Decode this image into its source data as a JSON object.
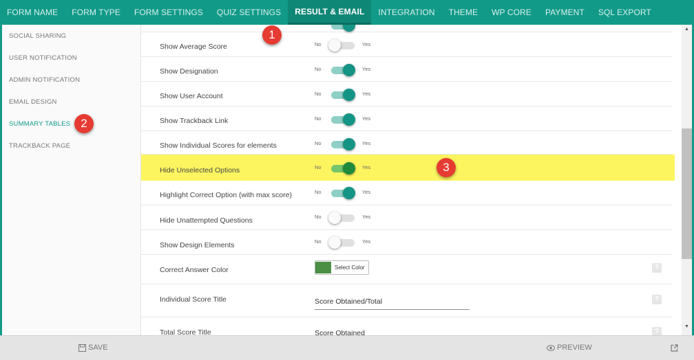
{
  "top_tabs": [
    {
      "label": "FORM NAME"
    },
    {
      "label": "FORM TYPE"
    },
    {
      "label": "FORM SETTINGS"
    },
    {
      "label": "QUIZ SETTINGS"
    },
    {
      "label": "RESULT & EMAIL",
      "active": true
    },
    {
      "label": "INTEGRATION"
    },
    {
      "label": "THEME"
    },
    {
      "label": "WP CORE"
    },
    {
      "label": "PAYMENT"
    },
    {
      "label": "SQL EXPORT"
    }
  ],
  "sidebar": {
    "items": [
      {
        "label": "SOCIAL SHARING"
      },
      {
        "label": "USER NOTIFICATION"
      },
      {
        "label": "ADMIN NOTIFICATION"
      },
      {
        "label": "EMAIL DESIGN"
      },
      {
        "label": "SUMMARY TABLES",
        "active": true
      },
      {
        "label": "TRACKBACK PAGE"
      }
    ]
  },
  "toggle_text": {
    "no": "No",
    "yes": "Yes"
  },
  "settings": [
    {
      "label": "Show Average Score",
      "state": "off"
    },
    {
      "label": "Show Designation",
      "state": "on"
    },
    {
      "label": "Show User Account",
      "state": "on"
    },
    {
      "label": "Show Trackback Link",
      "state": "on"
    },
    {
      "label": "Show Individual Scores for elements",
      "state": "on"
    },
    {
      "label": "Hide Unselected Options",
      "state": "on",
      "highlight": true
    },
    {
      "label": "Highlight Correct Option (with max score)",
      "state": "on"
    },
    {
      "label": "Hide Unattempted Questions",
      "state": "off"
    },
    {
      "label": "Show Design Elements",
      "state": "off"
    }
  ],
  "correct_answer_color": {
    "label": "Correct Answer Color",
    "button_label": "Select Color",
    "color": "#4a8f44"
  },
  "individual_score_title": {
    "label": "Individual Score Title",
    "value": "Score Obtained/Total"
  },
  "total_score_title": {
    "label": "Total Score Title",
    "value": "Score Obtained"
  },
  "help_icon": "?",
  "badges": [
    "1",
    "2",
    "3"
  ],
  "footer": {
    "save_label": "SAVE",
    "preview_label": "PREVIEW"
  },
  "colors": {
    "accent": "#129a88",
    "highlight": "#fdf560",
    "badge": "#e53b32"
  }
}
